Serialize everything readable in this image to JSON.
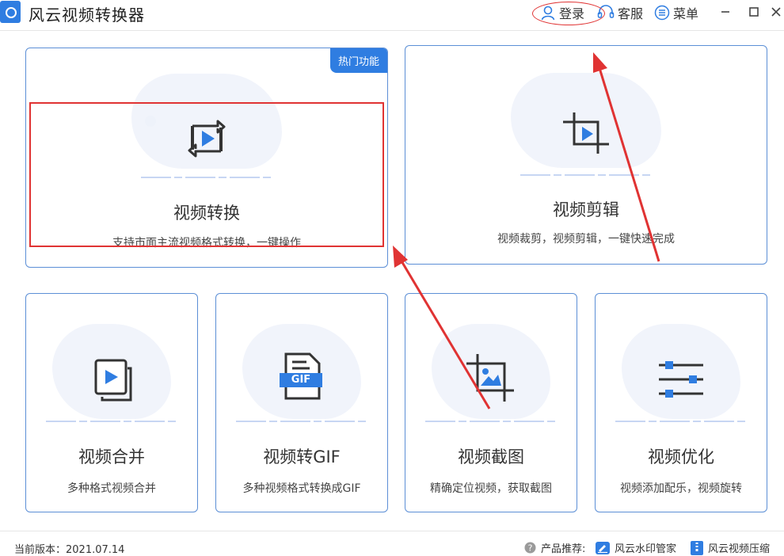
{
  "window": {
    "title": "风云视频转换器",
    "login": "登录",
    "service": "客服",
    "menu": "菜单"
  },
  "cards": {
    "convert": {
      "title": "视频转换",
      "desc": "支持市面主流视频格式转换，一键操作",
      "badge": "热门功能"
    },
    "edit": {
      "title": "视频剪辑",
      "desc": "视频裁剪，视频剪辑，一键快速完成"
    },
    "merge": {
      "title": "视频合并",
      "desc": "多种格式视频合并"
    },
    "gif": {
      "title": "视频转GIF",
      "desc": "多种视频格式转换成GIF",
      "icon_text": "GIF"
    },
    "screenshot": {
      "title": "视频截图",
      "desc": "精确定位视频，获取截图"
    },
    "optimize": {
      "title": "视频优化",
      "desc": "视频添加配乐，视频旋转"
    }
  },
  "footer": {
    "version": "当前版本：2021.07.14",
    "recommend": "产品推荐:",
    "product1": "风云水印管家",
    "product2": "风云视频压缩"
  },
  "colors": {
    "accent": "#2f7de1",
    "annotation": "#e03333",
    "card_border": "#5c8fd6"
  },
  "icons": [
    "app-logo-icon",
    "user-icon",
    "headset-icon",
    "menu-list-icon",
    "minimize-icon",
    "maximize-icon",
    "close-icon",
    "convert-video-icon",
    "crop-video-icon",
    "merge-video-icon",
    "gif-file-icon",
    "crop-image-icon",
    "sliders-icon",
    "help-icon",
    "watermark-icon",
    "compress-icon"
  ]
}
